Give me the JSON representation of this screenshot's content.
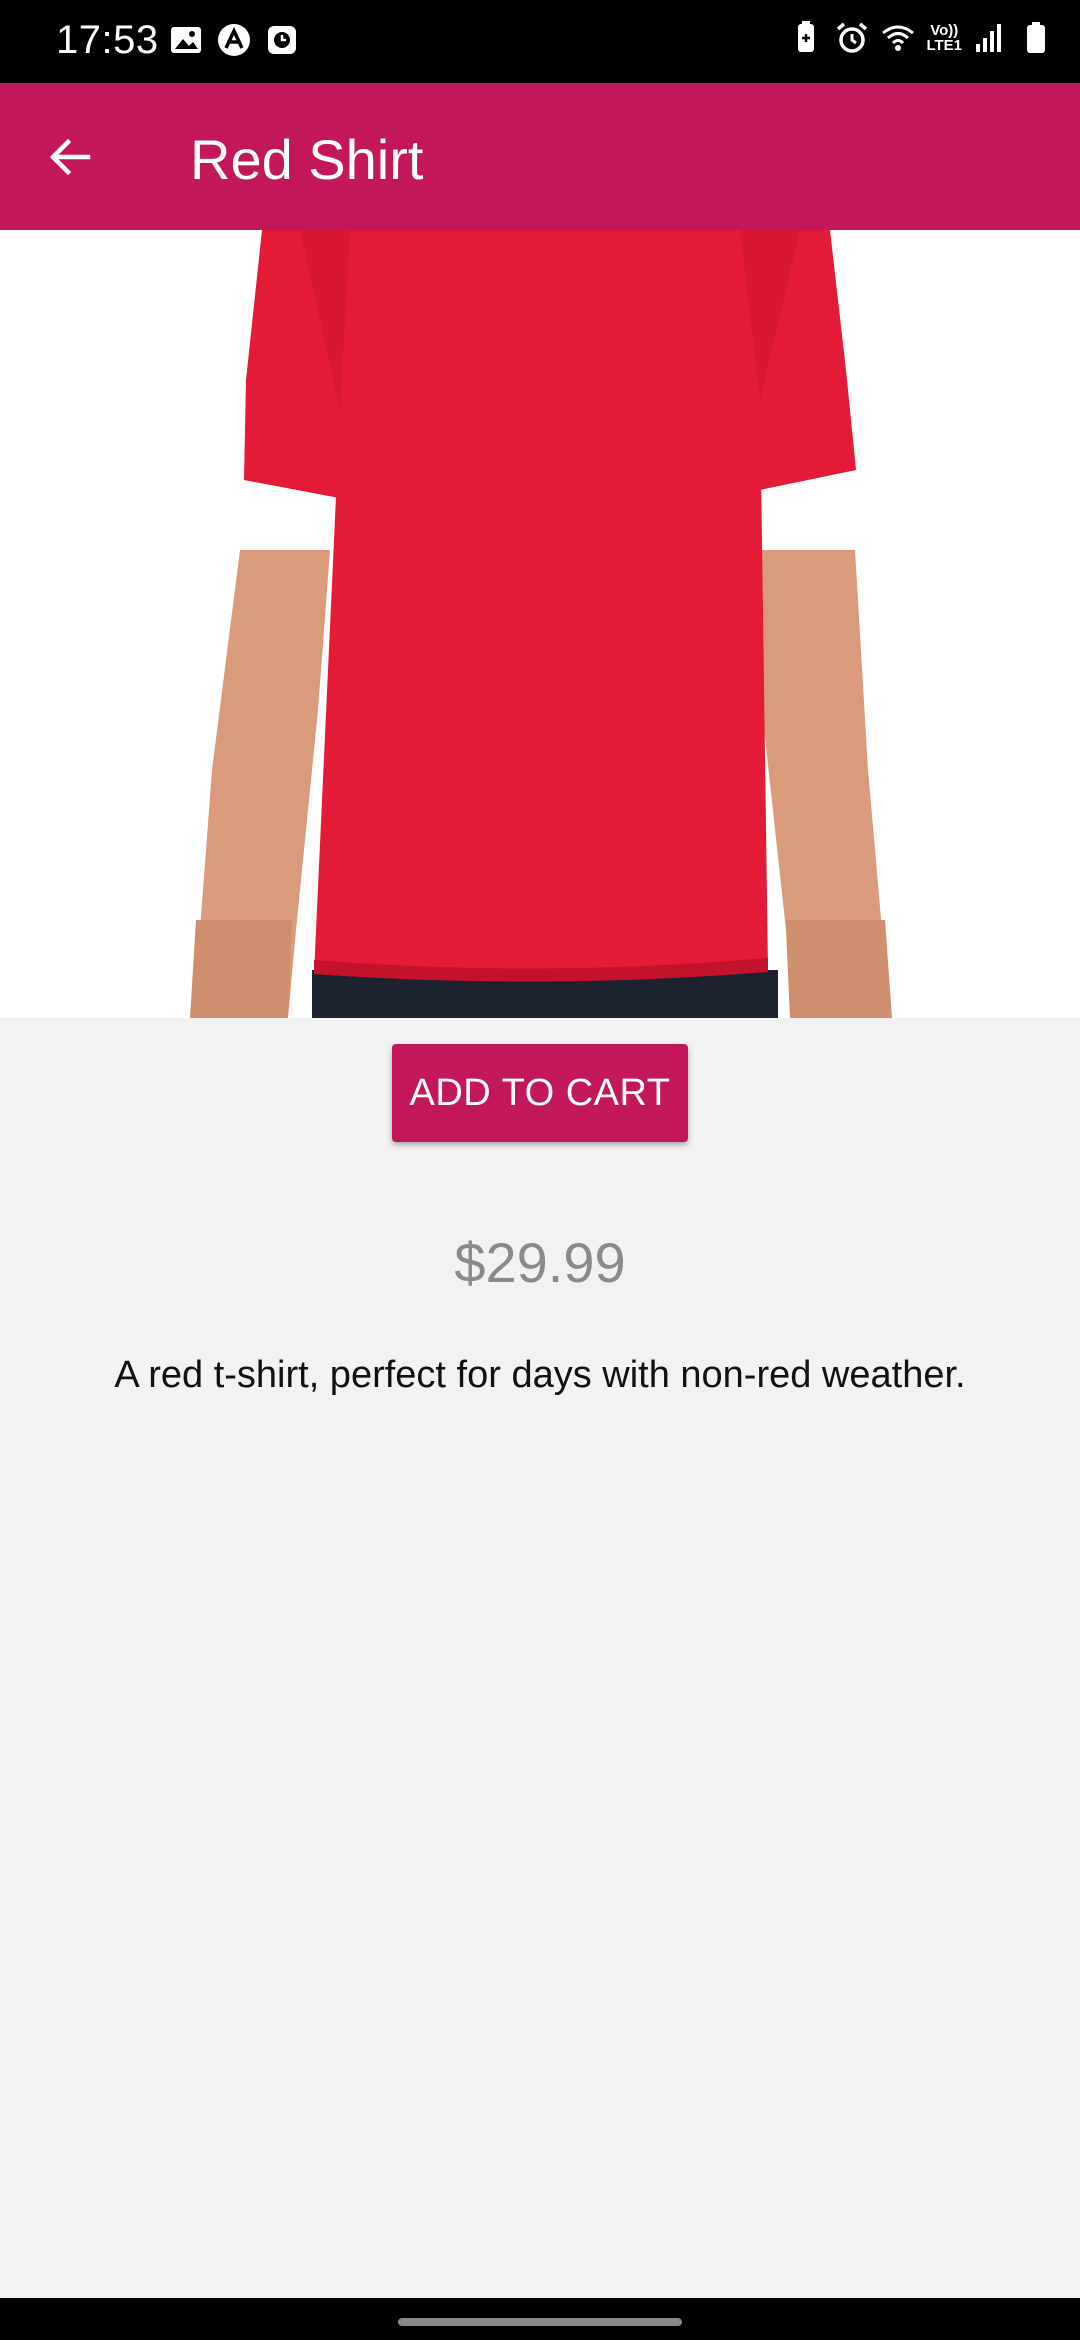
{
  "status_bar": {
    "time": "17:53",
    "left_icons": [
      "image-icon",
      "app-circle-icon",
      "clock-badge-icon"
    ],
    "right_icons": [
      "battery-saver-icon",
      "alarm-icon",
      "wifi-icon",
      "volte-lte1-icon",
      "signal-icon",
      "battery-icon"
    ],
    "network_label_top": "Vo))",
    "network_label_bottom": "LTE1"
  },
  "app_bar": {
    "title": "Red Shirt",
    "back_icon": "arrow-back-icon",
    "color": "#c2185b"
  },
  "product": {
    "add_to_cart_label": "ADD TO CART",
    "price": "$29.99",
    "description": "A red t-shirt, perfect for days with non-red weather.",
    "shirt_color": "#e31b37"
  }
}
